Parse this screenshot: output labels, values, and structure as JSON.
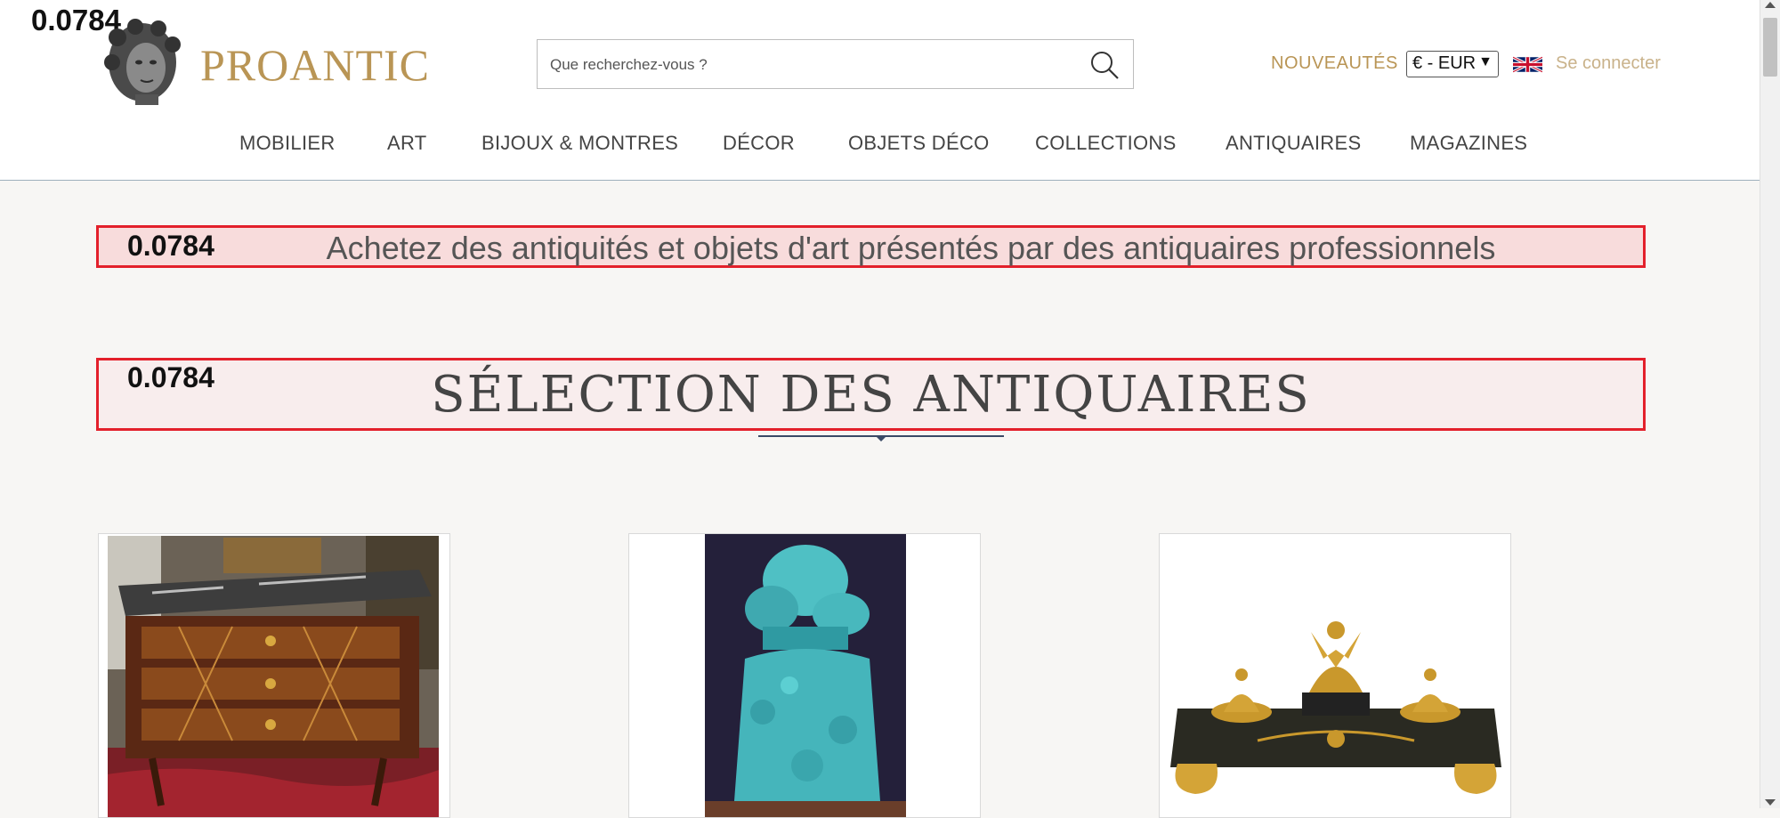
{
  "overlay_scores": {
    "top_left": "0.0784",
    "banner1": "0.0784",
    "banner2": "0.0784"
  },
  "header": {
    "brand": "PROANTIC",
    "search_placeholder": "Que recherchez-vous ?",
    "nouveautes": "NOUVEAUTÉS",
    "currency": "€ - EUR",
    "language_flag": "uk-flag-icon",
    "connect": "Se connecter"
  },
  "nav": {
    "items": [
      "MOBILIER",
      "ART",
      "BIJOUX & MONTRES",
      "DÉCOR",
      "OBJETS DÉCO",
      "COLLECTIONS",
      "ANTIQUAIRES",
      "MAGAZINES"
    ]
  },
  "banners": {
    "tagline": "Achetez des antiquités et objets d'art présentés par des antiquaires professionnels",
    "section_title": "SÉLECTION DES ANTIQUAIRES"
  },
  "products": [
    {
      "name": "marble-top-commode"
    },
    {
      "name": "turquoise-carved-vase"
    },
    {
      "name": "empire-eagle-inkwell"
    }
  ],
  "colors": {
    "brand_gold": "#b99555",
    "highlight_border": "#e3202b",
    "divider": "#3a4a66"
  }
}
